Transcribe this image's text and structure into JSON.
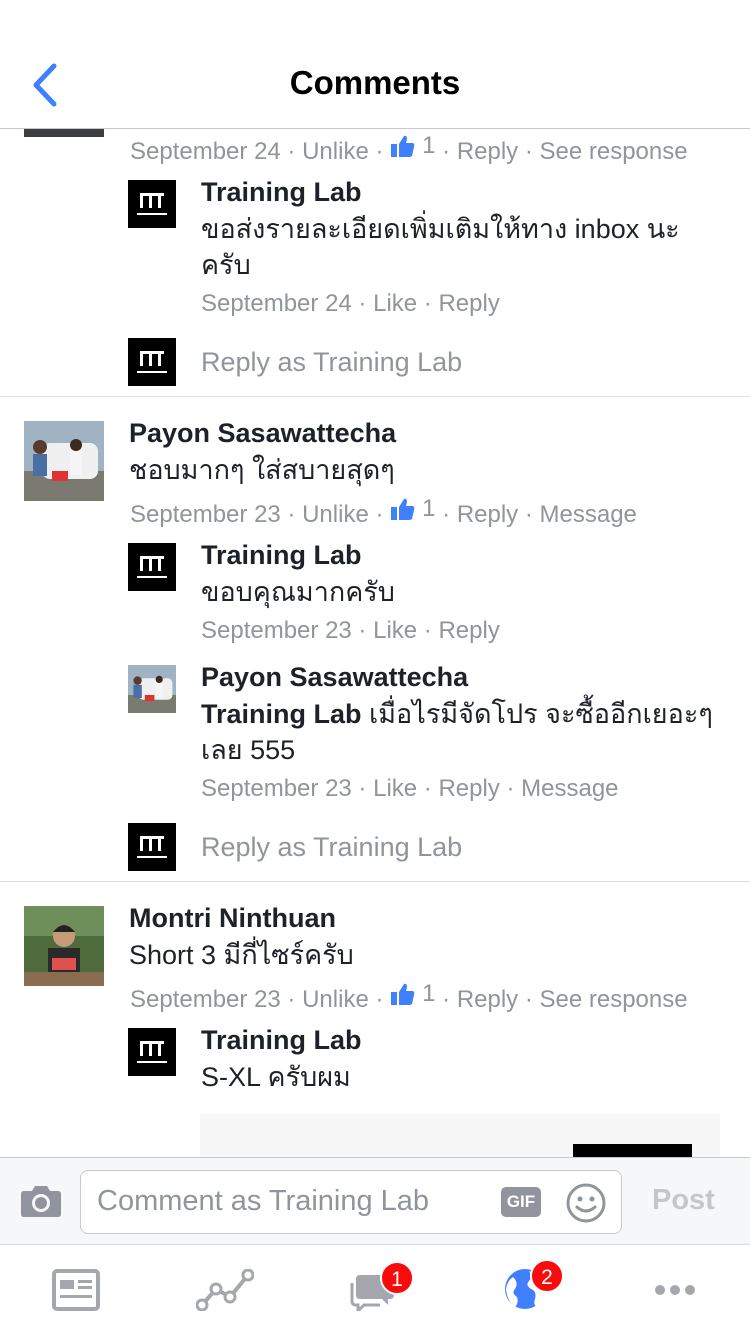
{
  "header": {
    "title": "Comments"
  },
  "thread1": {
    "meta": {
      "date": "September 24",
      "unlike": "Unlike",
      "likes": "1",
      "reply": "Reply",
      "extra": "See response"
    },
    "reply": {
      "name": "Training Lab",
      "text": "ขอส่งรายละเอียดเพิ่มเติมให้ทาง inbox นะครับ",
      "meta": {
        "date": "September 24",
        "like": "Like",
        "reply": "Reply"
      }
    },
    "reply_as": "Reply as Training Lab"
  },
  "thread2": {
    "name": "Payon Sasawattecha",
    "text": "ชอบมากๆ ใส่สบายสุดๆ",
    "meta": {
      "date": "September 23",
      "unlike": "Unlike",
      "likes": "1",
      "reply": "Reply",
      "extra": "Message"
    },
    "reply1": {
      "name": "Training Lab",
      "text": "ขอบคุณมากครับ",
      "meta": {
        "date": "September 23",
        "like": "Like",
        "reply": "Reply"
      }
    },
    "reply2": {
      "name": "Payon Sasawattecha",
      "mention": "Training Lab",
      "text": " เมื่อไรมีจัดโปร จะซื้ออีกเยอะๆ เลย 555",
      "meta": {
        "date": "September 23",
        "like": "Like",
        "reply": "Reply",
        "extra": "Message"
      }
    },
    "reply_as": "Reply as Training Lab"
  },
  "thread3": {
    "name": "Montri Ninthuan",
    "text": "Short 3 มีกี่ไซร์ครับ",
    "meta": {
      "date": "September 23",
      "unlike": "Unlike",
      "likes": "1",
      "reply": "Reply",
      "extra": "See response"
    },
    "reply": {
      "name": "Training Lab",
      "text": "S-XL ครับผม"
    }
  },
  "composer": {
    "placeholder": "Comment as Training Lab",
    "gif": "GIF",
    "post": "Post"
  },
  "tabbar": {
    "tabs": [
      {
        "icon": "news-feed-icon"
      },
      {
        "icon": "insights-icon"
      },
      {
        "icon": "messages-icon",
        "badge": "1"
      },
      {
        "icon": "notifications-globe-icon",
        "badge": "2"
      },
      {
        "icon": "more-icon"
      }
    ]
  },
  "colors": {
    "accent": "#4080ff",
    "meta_gray": "#90949c",
    "badge_red": "#fa0a0a"
  }
}
